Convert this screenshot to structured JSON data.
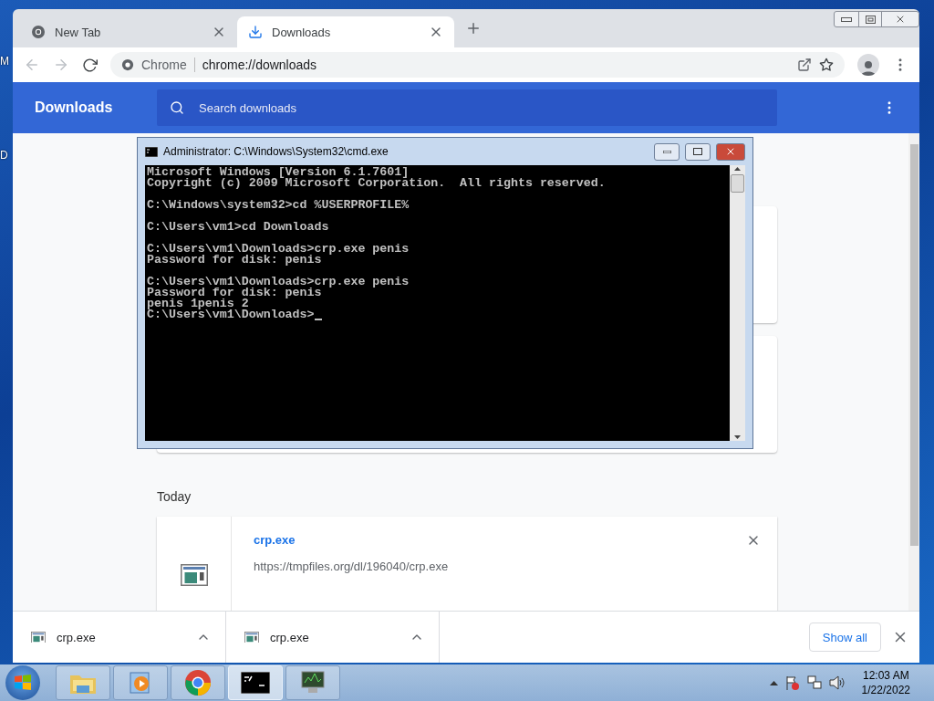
{
  "desktop": {
    "labels": [
      "M",
      "D"
    ]
  },
  "browser": {
    "tabs": [
      {
        "title": "New Tab",
        "kind": "newtab",
        "selected": false
      },
      {
        "title": "Downloads",
        "kind": "downloads",
        "selected": true
      }
    ],
    "omnibox": {
      "origin": "Chrome",
      "url": "chrome://downloads"
    },
    "header": {
      "title": "Downloads",
      "search_placeholder": "Search downloads"
    },
    "section_label": "Today",
    "item": {
      "name": "crp.exe",
      "url": "https://tmpfiles.org/dl/196040/crp.exe"
    },
    "shelf": {
      "items": [
        {
          "name": "crp.exe"
        },
        {
          "name": "crp.exe"
        }
      ],
      "show_all": "Show all"
    }
  },
  "console": {
    "title": "Administrator: C:\\Windows\\System32\\cmd.exe",
    "blocks": [
      [
        "Microsoft Windows [Version 6.1.7601]",
        "Copyright (c) 2009 Microsoft Corporation.  All rights reserved."
      ],
      [
        "C:\\Windows\\system32>cd %USERPROFILE%"
      ],
      [
        "C:\\Users\\vm1>cd Downloads"
      ],
      [
        "C:\\Users\\vm1\\Downloads>crp.exe penis",
        "Password for disk: penis"
      ],
      [
        "C:\\Users\\vm1\\Downloads>crp.exe penis",
        "Password for disk: penis",
        "penis 1penis 2",
        "C:\\Users\\vm1\\Downloads>"
      ]
    ],
    "cursor": true
  },
  "taskbar": {
    "apps": [
      {
        "kind": "explorer",
        "selected": false
      },
      {
        "kind": "media",
        "selected": false
      },
      {
        "kind": "chrome",
        "selected": false
      },
      {
        "kind": "cmd",
        "selected": true
      },
      {
        "kind": "monitor",
        "selected": false
      }
    ],
    "time": "12:03 AM",
    "date": "1/22/2022"
  }
}
